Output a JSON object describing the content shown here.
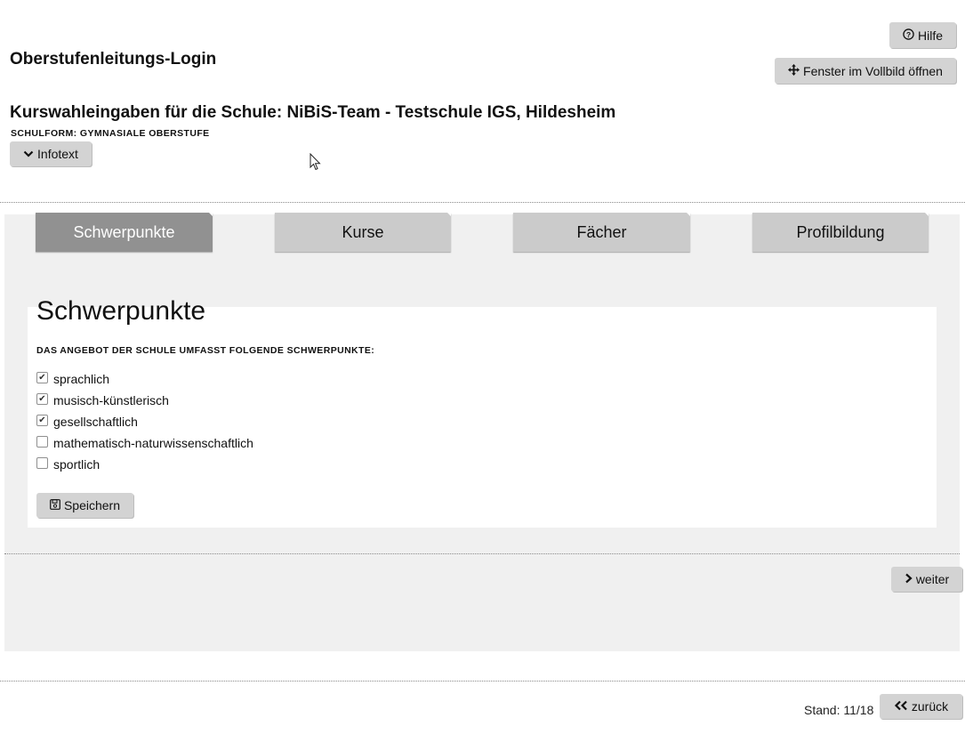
{
  "header": {
    "help_label": "Hilfe",
    "fullscreen_label": "Fenster im Vollbild öffnen",
    "login_title": "Oberstufenleitungs-Login",
    "school_title": "Kurswahleingaben für die Schule: NiBiS-Team - Testschule IGS, Hildesheim",
    "schulform": "SCHULFORM: GYMNASIALE OBERSTUFE",
    "infotext_label": "Infotext"
  },
  "tabs": [
    {
      "label": "Schwerpunkte",
      "active": true
    },
    {
      "label": "Kurse",
      "active": false
    },
    {
      "label": "Fächer",
      "active": false
    },
    {
      "label": "Profilbildung",
      "active": false
    }
  ],
  "main": {
    "title": "Schwerpunkte",
    "section_label": "DAS ANGEBOT DER SCHULE UMFASST FOLGENDE SCHWERPUNKTE:",
    "options": [
      {
        "label": "sprachlich",
        "checked": true
      },
      {
        "label": "musisch-künstlerisch",
        "checked": true
      },
      {
        "label": "gesellschaftlich",
        "checked": true
      },
      {
        "label": "mathematisch-naturwissenschaftlich",
        "checked": false
      },
      {
        "label": "sportlich",
        "checked": false
      }
    ],
    "save_label": "Speichern",
    "weiter_label": "weiter"
  },
  "footer": {
    "stand": "Stand: 11/18",
    "zurueck_label": "zurück"
  },
  "icons": {
    "help": "question-circle-icon",
    "fullscreen": "arrows-move-icon",
    "infotext": "chevron-down-icon",
    "save": "floppy-disk-icon",
    "weiter": "chevron-right-icon",
    "zurueck": "double-chevron-left-icon"
  },
  "colors": {
    "button_bg": "#d3d3d3",
    "tab_bg": "#cbcbcb",
    "tab_active_bg": "#919191",
    "panel_bg": "#f0f0f0"
  }
}
